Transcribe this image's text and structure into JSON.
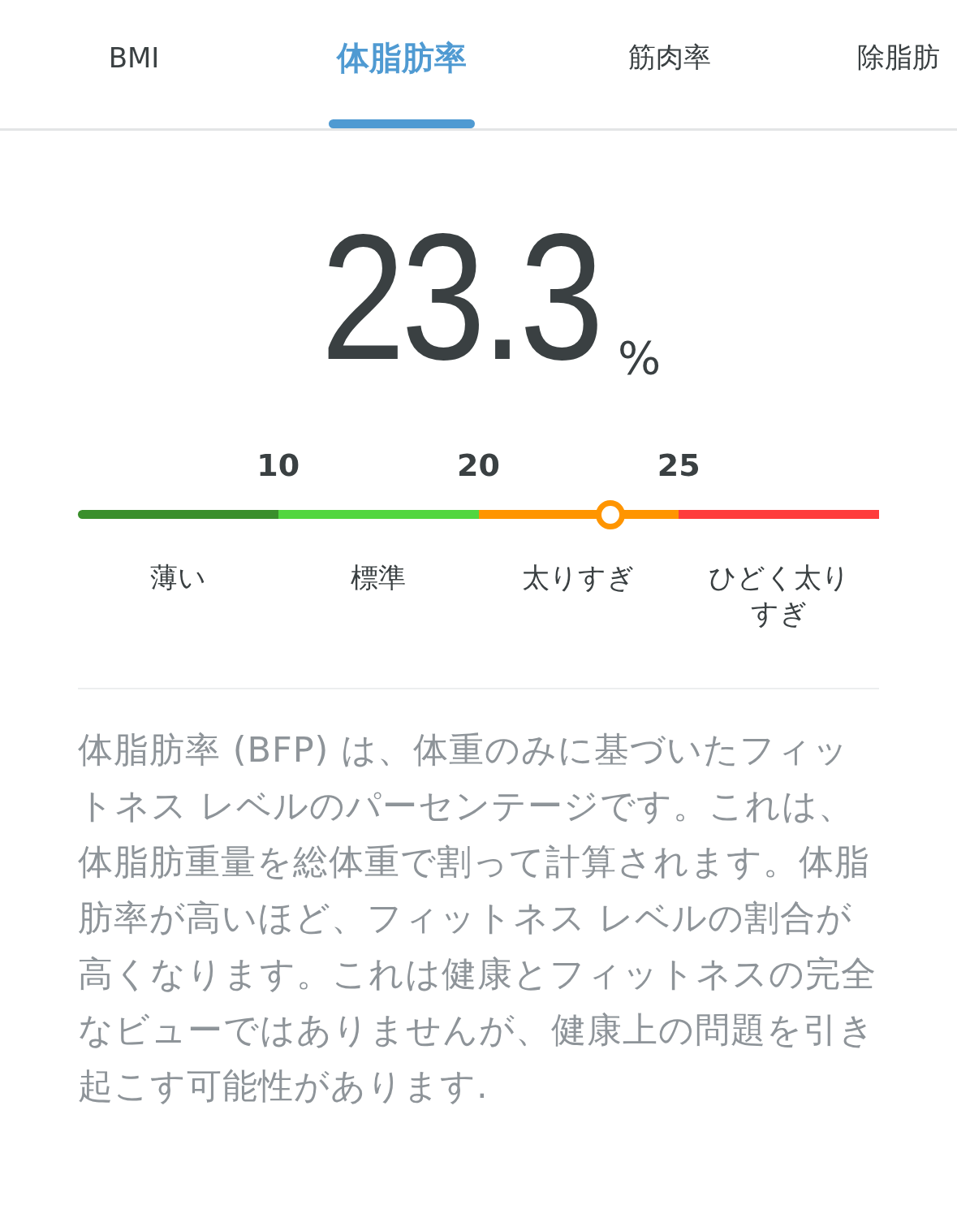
{
  "tabs": [
    {
      "label": "BMI",
      "selected": false
    },
    {
      "label": "体脂肪率",
      "selected": true
    },
    {
      "label": "筋肉率",
      "selected": false
    },
    {
      "label": "除脂肪",
      "selected": false
    }
  ],
  "reading": {
    "value": "23.3",
    "unit": "%"
  },
  "scale": {
    "ticks": [
      "10",
      "20",
      "25"
    ],
    "level": 0.665,
    "segments": [
      {
        "label": "薄い",
        "color": "#3a8f2c"
      },
      {
        "label": "標準",
        "color": "#52d63f"
      },
      {
        "label": "太りすぎ",
        "color": "#ff9500"
      },
      {
        "label": "ひどく太りすぎ",
        "color": "#ff3b3b"
      }
    ]
  },
  "description": "体脂肪率 (BFP) は、体重のみに基づいたフィットネス レベルのパーセンテージです。これは、体脂肪重量を総体重で割って計算されます。体脂肪率が高いほど、フィットネス レベルの割合が高くなります。これは健康とフィットネスの完全なビューではありませんが、健康上の問題を引き起こす可能性があります."
}
